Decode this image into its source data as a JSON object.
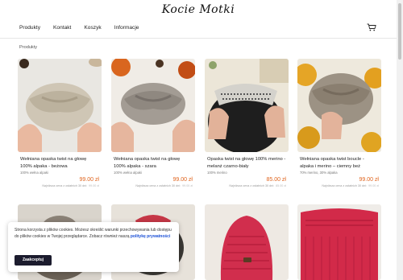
{
  "site": {
    "logo": "Kocie Motki",
    "nav": [
      "Produkty",
      "Kontakt",
      "Koszyk",
      "Informacje"
    ]
  },
  "breadcrumb": "Produkty",
  "products": [
    {
      "title": "Wełniana opaska twist na głowę 100% alpaka - beżowa",
      "subtitle": "100% wełna alpaki",
      "price": "99.00 zł",
      "lowest_label": "Najniższa cena z ostatnich 30 dni:",
      "lowest_value": "99.00 zł"
    },
    {
      "title": "Wełniana opaska twist na głowę 100% alpaka - szara",
      "subtitle": "100% wełna alpaki",
      "price": "99.00 zł",
      "lowest_label": "Najniższa cena z ostatnich 30 dni:",
      "lowest_value": "99.00 zł"
    },
    {
      "title": "Opaska twist na głowę 100% merino - melanż czarno-biały",
      "subtitle": "100% merino",
      "price": "85.00 zł",
      "lowest_label": "Najniższa cena z ostatnich 30 dni:",
      "lowest_value": "85.00 zł"
    },
    {
      "title": "Wełniana opaska twist boucle - alpaka i merino – ciemny beż",
      "subtitle": "70% merino, 30% alpaka",
      "price": "99.00 zł",
      "lowest_label": "Najniższa cena z ostatnich 30 dni:",
      "lowest_value": "99.00 zł"
    }
  ],
  "cookie": {
    "text": "Strona korzysta z plików cookies. Możesz określić warunki przechowywania lub dostępu do plików cookies w Twojej przeglądarce. Zobacz również naszą",
    "link": "politykę prywatności",
    "button": "Zaakceptuj"
  },
  "colors": {
    "price": "#e0651f",
    "accept_button": "#1c1c2e",
    "link": "#1a4fd6"
  },
  "icons": {
    "cart": "cart-icon"
  }
}
